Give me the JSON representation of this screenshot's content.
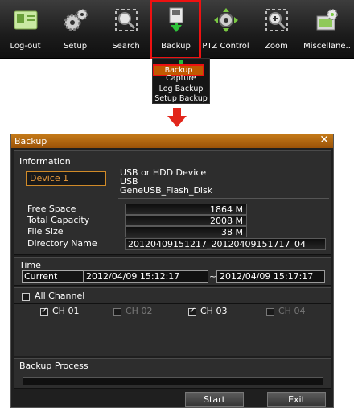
{
  "toolbar": {
    "items": [
      {
        "label": "Log-out",
        "icon": "logout-card-icon"
      },
      {
        "label": "Setup",
        "icon": "gears-icon"
      },
      {
        "label": "Search",
        "icon": "search-icon"
      },
      {
        "label": "Backup",
        "icon": "backup-icon"
      },
      {
        "label": "PTZ Control",
        "icon": "ptz-camera-icon"
      },
      {
        "label": "Zoom",
        "icon": "zoom-icon"
      },
      {
        "label": "Miscellane..",
        "icon": "misc-icon"
      }
    ],
    "selected": "Backup"
  },
  "backup_menu": {
    "items": [
      "Backup",
      "Capture",
      "Log Backup",
      "Setup Backup"
    ],
    "active": "Backup"
  },
  "dialog": {
    "title": "Backup",
    "close_symbol": "✕",
    "information": {
      "header": "Information",
      "device_select": "Device 1",
      "device_lines": [
        "USB or HDD Device",
        "USB",
        "GeneUSB_Flash_Disk"
      ],
      "rows": [
        {
          "label": "Free Space",
          "value": "1864 M"
        },
        {
          "label": "Total Capacity",
          "value": "2008 M"
        },
        {
          "label": "File Size",
          "value": "38 M"
        },
        {
          "label": "Directory Name",
          "value": "20120409151217_20120409151717_04"
        }
      ]
    },
    "time": {
      "header": "Time",
      "mode_select": "Current",
      "start": "2012/04/09  15:12:17",
      "separator": "~",
      "end": "2012/04/09  15:17:17"
    },
    "channels": {
      "all_label": "All Channel",
      "all_checked": false,
      "items": [
        {
          "label": "CH 01",
          "checked": true,
          "enabled": true
        },
        {
          "label": "CH 02",
          "checked": false,
          "enabled": false
        },
        {
          "label": "CH 03",
          "checked": true,
          "enabled": true
        },
        {
          "label": "CH 04",
          "checked": false,
          "enabled": false
        }
      ]
    },
    "process": {
      "header": "Backup Process",
      "progress": 0
    },
    "buttons": {
      "start": "Start",
      "exit": "Exit"
    }
  },
  "colors": {
    "accent_orange": "#c47a19",
    "highlight_red": "#e2261b",
    "panel_bg": "#2d2d2d"
  }
}
